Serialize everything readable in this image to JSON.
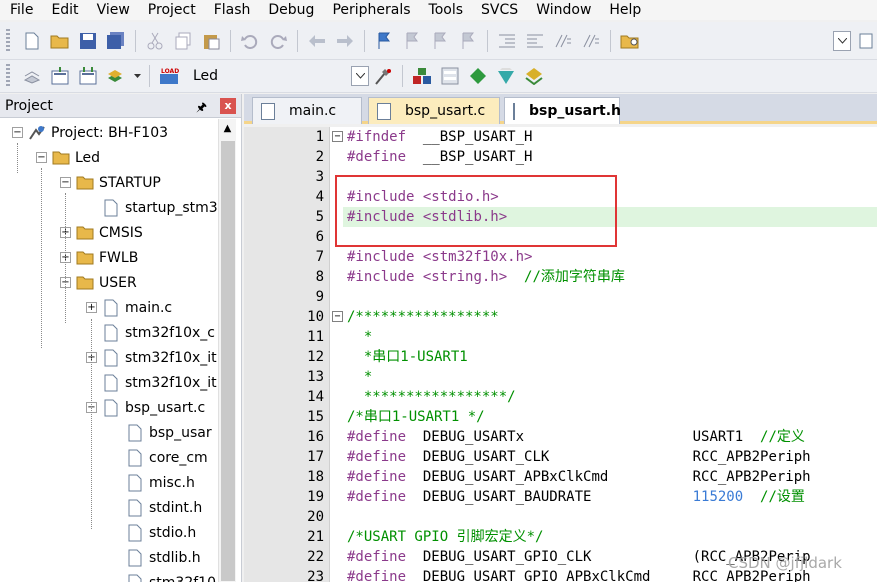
{
  "menu": [
    "File",
    "Edit",
    "View",
    "Project",
    "Flash",
    "Debug",
    "Peripherals",
    "Tools",
    "SVCS",
    "Window",
    "Help"
  ],
  "toolbar": {
    "target": "Led"
  },
  "panel": {
    "title": "Project",
    "pin": "ᵠ",
    "close": "x"
  },
  "tree": [
    {
      "label": "Project: BH-F103",
      "depth": 0,
      "exp": "−",
      "icon": "project-icon"
    },
    {
      "label": "Led",
      "depth": 1,
      "exp": "−",
      "icon": "folder-icon"
    },
    {
      "label": "STARTUP",
      "depth": 2,
      "exp": "−",
      "icon": "folder-icon"
    },
    {
      "label": "startup_stm3",
      "depth": 3,
      "exp": "",
      "icon": "file-icon"
    },
    {
      "label": "CMSIS",
      "depth": 2,
      "exp": "+",
      "icon": "folder-icon"
    },
    {
      "label": "FWLB",
      "depth": 2,
      "exp": "+",
      "icon": "folder-icon"
    },
    {
      "label": "USER",
      "depth": 2,
      "exp": "−",
      "icon": "folder-icon"
    },
    {
      "label": "main.c",
      "depth": 3,
      "exp": "+",
      "icon": "file-icon"
    },
    {
      "label": "stm32f10x_c",
      "depth": 3,
      "exp": "",
      "icon": "file-icon"
    },
    {
      "label": "stm32f10x_it",
      "depth": 3,
      "exp": "+",
      "icon": "file-icon"
    },
    {
      "label": "stm32f10x_it",
      "depth": 3,
      "exp": "",
      "icon": "file-icon"
    },
    {
      "label": "bsp_usart.c",
      "depth": 3,
      "exp": "−",
      "icon": "file-icon"
    },
    {
      "label": "bsp_usar",
      "depth": 4,
      "exp": "",
      "icon": "file-icon"
    },
    {
      "label": "core_cm",
      "depth": 4,
      "exp": "",
      "icon": "file-icon"
    },
    {
      "label": "misc.h",
      "depth": 4,
      "exp": "",
      "icon": "file-icon"
    },
    {
      "label": "stdint.h",
      "depth": 4,
      "exp": "",
      "icon": "file-icon"
    },
    {
      "label": "stdio.h",
      "depth": 4,
      "exp": "",
      "icon": "file-icon"
    },
    {
      "label": "stdlib.h",
      "depth": 4,
      "exp": "",
      "icon": "file-icon"
    },
    {
      "label": "stm32f10",
      "depth": 4,
      "exp": "",
      "icon": "file-icon"
    }
  ],
  "tabs": [
    {
      "label": "main.c",
      "state": "normal"
    },
    {
      "label": "bsp_usart.c",
      "state": "modified"
    },
    {
      "label": "bsp_usart.h",
      "state": "active"
    }
  ],
  "lines": [
    {
      "n": "1",
      "fold": "−",
      "hl": false,
      "parts": [
        [
          "pp",
          "#ifndef"
        ],
        [
          "kw",
          "  __BSP_USART_H"
        ]
      ]
    },
    {
      "n": "2",
      "fold": "",
      "hl": false,
      "parts": [
        [
          "pp",
          "#define"
        ],
        [
          "kw",
          "  __BSP_USART_H"
        ]
      ]
    },
    {
      "n": "3",
      "fold": "",
      "hl": false,
      "parts": []
    },
    {
      "n": "4",
      "fold": "",
      "hl": false,
      "parts": [
        [
          "pp",
          "#include"
        ],
        [
          "kw",
          " "
        ],
        [
          "inc",
          "<stdio.h>"
        ]
      ]
    },
    {
      "n": "5",
      "fold": "",
      "hl": true,
      "parts": [
        [
          "pp",
          "#include"
        ],
        [
          "kw",
          " "
        ],
        [
          "inc",
          "<stdlib.h>"
        ]
      ]
    },
    {
      "n": "6",
      "fold": "",
      "hl": false,
      "parts": []
    },
    {
      "n": "7",
      "fold": "",
      "hl": false,
      "parts": [
        [
          "pp",
          "#include"
        ],
        [
          "kw",
          " "
        ],
        [
          "inc",
          "<stm32f10x.h>"
        ]
      ]
    },
    {
      "n": "8",
      "fold": "",
      "hl": false,
      "parts": [
        [
          "pp",
          "#include"
        ],
        [
          "kw",
          " "
        ],
        [
          "inc",
          "<string.h>"
        ],
        [
          "kw",
          "  "
        ],
        [
          "cm",
          "//添加字符串库"
        ]
      ]
    },
    {
      "n": "9",
      "fold": "",
      "hl": false,
      "parts": []
    },
    {
      "n": "10",
      "fold": "−",
      "hl": false,
      "parts": [
        [
          "cm",
          "/*****************"
        ]
      ]
    },
    {
      "n": "11",
      "fold": "",
      "hl": false,
      "parts": [
        [
          "cm",
          "  *"
        ]
      ]
    },
    {
      "n": "12",
      "fold": "",
      "hl": false,
      "parts": [
        [
          "cm",
          "  *串口1-USART1"
        ]
      ]
    },
    {
      "n": "13",
      "fold": "",
      "hl": false,
      "parts": [
        [
          "cm",
          "  *"
        ]
      ]
    },
    {
      "n": "14",
      "fold": "",
      "hl": false,
      "parts": [
        [
          "cm",
          "  *****************/"
        ]
      ]
    },
    {
      "n": "15",
      "fold": "",
      "hl": false,
      "parts": [
        [
          "cm",
          "/*串口1-USART1 */"
        ]
      ]
    },
    {
      "n": "16",
      "fold": "",
      "hl": false,
      "parts": [
        [
          "pp",
          "#define"
        ],
        [
          "kw",
          "  DEBUG_USARTx                    USART1  "
        ],
        [
          "cm",
          "//定义"
        ]
      ]
    },
    {
      "n": "17",
      "fold": "",
      "hl": false,
      "parts": [
        [
          "pp",
          "#define"
        ],
        [
          "kw",
          "  DEBUG_USART_CLK                 RCC_APB2Periph"
        ]
      ]
    },
    {
      "n": "18",
      "fold": "",
      "hl": false,
      "parts": [
        [
          "pp",
          "#define"
        ],
        [
          "kw",
          "  DEBUG_USART_APBxClkCmd          RCC_APB2Periph"
        ]
      ]
    },
    {
      "n": "19",
      "fold": "",
      "hl": false,
      "parts": [
        [
          "pp",
          "#define"
        ],
        [
          "kw",
          "  DEBUG_USART_BAUDRATE            "
        ],
        [
          "num",
          "115200"
        ],
        [
          "kw",
          "  "
        ],
        [
          "cm",
          "//设置"
        ]
      ]
    },
    {
      "n": "20",
      "fold": "",
      "hl": false,
      "parts": []
    },
    {
      "n": "21",
      "fold": "",
      "hl": false,
      "parts": [
        [
          "cm",
          "/*USART GPIO 引脚宏定义*/"
        ]
      ]
    },
    {
      "n": "22",
      "fold": "",
      "hl": false,
      "parts": [
        [
          "pp",
          "#define"
        ],
        [
          "kw",
          "  DEBUG_USART_GPIO_CLK            (RCC_APB2Perip"
        ]
      ]
    },
    {
      "n": "23",
      "fold": "",
      "hl": false,
      "parts": [
        [
          "pp",
          "#define"
        ],
        [
          "kw",
          "  DEBUG_USART_GPIO_APBxClkCmd     RCC_APB2Periph"
        ]
      ]
    }
  ],
  "watermark": "CSDN @jfjldark"
}
